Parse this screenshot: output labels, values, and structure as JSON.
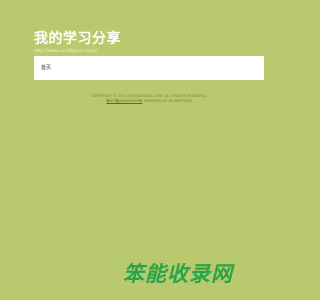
{
  "header": {
    "title": "我的学习分享",
    "url": "http://www.xxxbbbxxx.com/"
  },
  "main": {
    "content": "首页"
  },
  "footer": {
    "line1": "COPYRIGHT © 2023 XXXXXXXXXX.COM. ALL RIGHTS RESERVED.",
    "icp_link": "粤ICP备XXXXXXXX号",
    "line2_rest": "POWERED BY WORDPRESS"
  },
  "watermark": {
    "chars": [
      "笨",
      "能",
      "收",
      "录",
      "网"
    ]
  },
  "colors": {
    "background": "#b8c96e",
    "content_box": "#ffffff",
    "watermark": "#2aa44a"
  }
}
